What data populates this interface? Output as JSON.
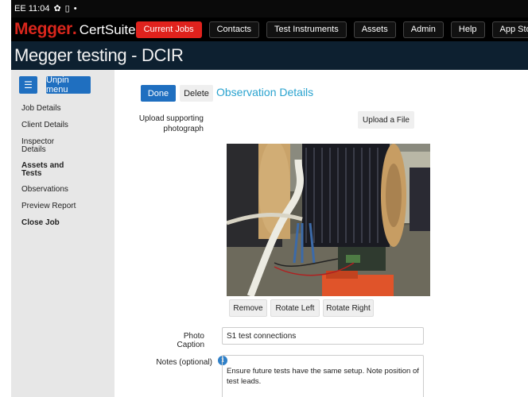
{
  "status_bar": {
    "time": "EE 11:04",
    "icons": [
      "gear-icon",
      "sim-icon",
      "dot-icon"
    ]
  },
  "brand": {
    "name": "Megger",
    "dot": ".",
    "product": "CertSuite"
  },
  "nav": {
    "items": [
      {
        "label": "Current Jobs",
        "active": true
      },
      {
        "label": "Contacts"
      },
      {
        "label": "Test Instruments"
      },
      {
        "label": "Assets"
      },
      {
        "label": "Admin"
      },
      {
        "label": "Help"
      },
      {
        "label": "App Storage Manager"
      }
    ]
  },
  "page_title": "Megger testing - DCIR",
  "sidebar": {
    "menu_icon": "hamburger-icon",
    "unpin_label": "Unpin menu",
    "items": [
      {
        "label": "Job Details"
      },
      {
        "label": "Client Details"
      },
      {
        "label": "Inspector Details"
      },
      {
        "label": "Assets and Tests",
        "bold": true
      },
      {
        "label": "Observations"
      },
      {
        "label": "Preview Report"
      },
      {
        "label": "Close Job",
        "bold": true
      }
    ]
  },
  "form": {
    "done_label": "Done",
    "delete_label": "Delete",
    "heading": "Observation Details",
    "upload_label": "Upload supporting photograph",
    "upload_button": "Upload a File",
    "photo_buttons": {
      "remove": "Remove",
      "rotate_left": "Rotate Left",
      "rotate_right": "Rotate Right"
    },
    "caption_label": "Photo Caption",
    "caption_value": "S1 test connections",
    "notes_label": "Notes (optional)",
    "notes_value": "Ensure future tests have the same setup. Note position of test leads."
  },
  "colors": {
    "brand_red": "#d9261c",
    "active_nav": "#e0221d",
    "primary_blue": "#1f6fc0",
    "heading_teal": "#2aa3cf",
    "title_bar": "#0d2030"
  }
}
